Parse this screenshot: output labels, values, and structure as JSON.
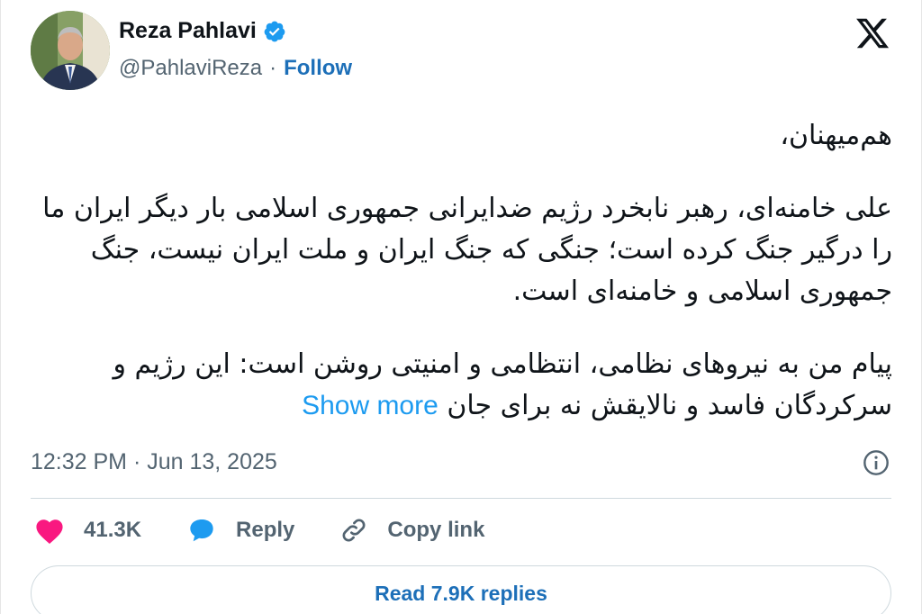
{
  "author": {
    "name": "Reza Pahlavi",
    "handle": "@PahlaviReza",
    "separator": "·",
    "follow_label": "Follow"
  },
  "icons": {
    "verified": "verified-badge-icon",
    "platform": "x-logo-icon",
    "info": "info-icon",
    "like": "heart-icon",
    "reply": "reply-bubble-icon",
    "copy": "link-icon"
  },
  "tweet": {
    "greeting": "هم‌میهنان،",
    "paragraph1": "علی خامنه‌ای، رهبر نابخرد رژیم ضدایرانی جمهوری اسلامی بار دیگر ایران ما را درگیر جنگ کرده است؛ جنگی که جنگ ایران و ملت ایران نیست، جنگ جمهوری اسلامی و خامنه‌ای است.",
    "paragraph2": "پیام من به نیروهای نظامی، انتظامی و امنیتی روشن است: این رژیم و سرکردگان فاسد و نالایقش نه برای جان",
    "show_more": "Show more"
  },
  "meta": {
    "timestamp": "12:32 PM · Jun 13, 2025"
  },
  "actions": {
    "likes": "41.3K",
    "reply": "Reply",
    "copy_link": "Copy link"
  },
  "read_replies": "Read 7.9K replies",
  "colors": {
    "accent_blue": "#1d9bf0",
    "link_blue": "#1d6fb8",
    "heart": "#f91880",
    "muted": "#536471"
  }
}
